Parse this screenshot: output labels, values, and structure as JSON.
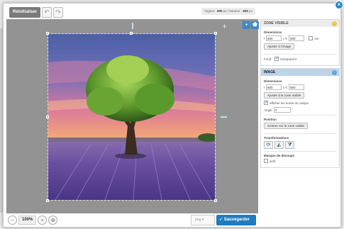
{
  "toolbar": {
    "reset_label": "Réinitialiser",
    "undo_icon": "undo-icon",
    "redo_icon": "redo-icon"
  },
  "dims": {
    "width_label": "largeur :",
    "width": "600",
    "unit": "px",
    "height_label": "/ hauteur :",
    "height": "600"
  },
  "canvas_tools": {
    "add_icon": "plus-icon",
    "pin_icon": "pin-icon"
  },
  "bottom": {
    "zoom_out_icon": "zoom-out-icon",
    "zoom_value": "100%",
    "zoom_in_icon": "zoom-in-icon",
    "fit_icon": "fit-icon",
    "format_value": "png",
    "save_label": "Sauvegarder"
  },
  "panel": {
    "zone": {
      "title": "ZONE VISIBLE",
      "dimensions_label": "Dimensions",
      "l_label": "l",
      "width_value": "600",
      "xh_label": "x h",
      "height_value": "600",
      "car_label": "car",
      "fit_button": "Ajuster à l'image",
      "fond_label": "Fond",
      "transparent_label": "transparent"
    },
    "image": {
      "title": "IMAGE",
      "dimensions_label": "Dimensions",
      "l_label": "l",
      "width_value": "600",
      "xh_label": "x h",
      "height_value": "600",
      "fit_button": "Ajuster à la zone visible",
      "show_borders_label": "afficher les bords du calque",
      "angle_label": "Angle",
      "angle_value": "0",
      "degree_symbol": "°",
      "position_label": "Position",
      "center_button": "Centrer sur la zone visible",
      "transform_label": "Transformations",
      "mask_label": "Masque de découpe",
      "actif_label": "actif"
    }
  },
  "colors": {
    "accent": "#1f7bbd",
    "header_active": "#bcd4e8",
    "canvas_bg": "#939393"
  }
}
